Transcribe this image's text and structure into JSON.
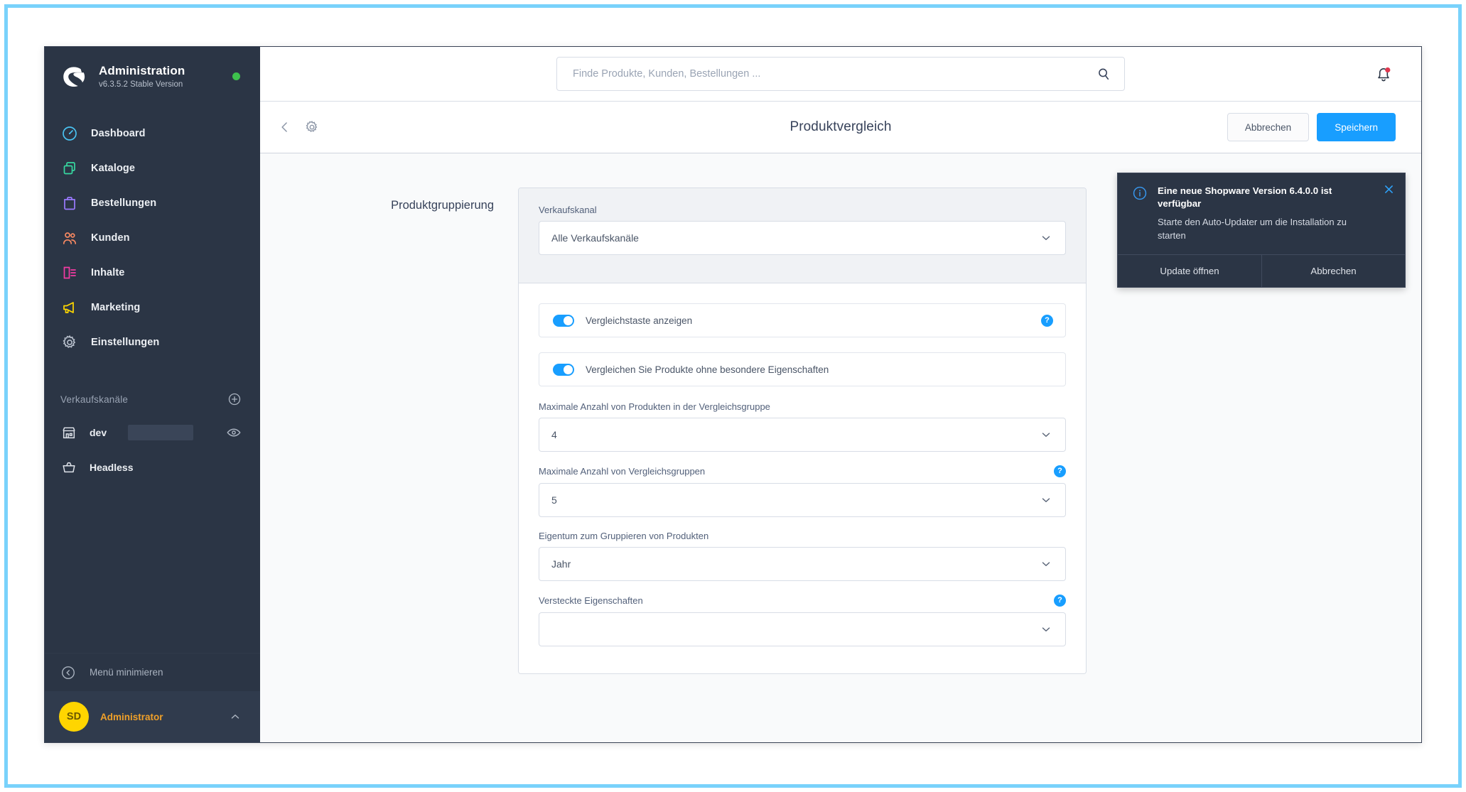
{
  "brand": {
    "title": "Administration",
    "version": "v6.3.5.2 Stable Version",
    "status_color": "#3ec14d",
    "logo_icon": "shopware-logo-icon"
  },
  "sidebar": {
    "items": [
      {
        "label": "Dashboard",
        "icon": "dashboard-icon",
        "color": "#49c2f1"
      },
      {
        "label": "Kataloge",
        "icon": "catalog-icon",
        "color": "#37d8a0"
      },
      {
        "label": "Bestellungen",
        "icon": "orders-bag-icon",
        "color": "#9b7aff"
      },
      {
        "label": "Kunden",
        "icon": "customers-icon",
        "color": "#f88962"
      },
      {
        "label": "Inhalte",
        "icon": "content-icon",
        "color": "#f33ba3"
      },
      {
        "label": "Marketing",
        "icon": "megaphone-icon",
        "color": "#ffd700"
      },
      {
        "label": "Einstellungen",
        "icon": "gear-icon",
        "color": "#b9c1cd"
      }
    ],
    "channels_section": {
      "title": "Verkaufskanäle",
      "add_icon": "plus-circle-icon",
      "items": [
        {
          "label": "dev",
          "icon": "storefront-icon",
          "trailing_icon": "eye-icon",
          "redacted": true
        },
        {
          "label": "Headless",
          "icon": "basket-icon",
          "trailing_icon": "",
          "redacted": false
        }
      ]
    },
    "minimize": {
      "label": "Menü minimieren",
      "icon": "chevron-left-circle-icon"
    },
    "user": {
      "initials": "SD",
      "name": "Administrator",
      "chevron_icon": "chevron-up-icon",
      "avatar_color": "#ffd500",
      "name_color": "#f0a029"
    }
  },
  "topbar": {
    "search": {
      "placeholder": "Finde Produkte, Kunden, Bestellungen ...",
      "value": "",
      "icon": "search-icon"
    },
    "notifications": {
      "icon": "bell-icon",
      "has_badge": true,
      "badge_color": "#e0384f"
    }
  },
  "pagehead": {
    "back_icon": "chevron-left-icon",
    "settings_icon": "gear-icon",
    "title": "Produktvergleich",
    "cancel_label": "Abbrechen",
    "save_label": "Speichern",
    "primary_color": "#189eff"
  },
  "main": {
    "card_label": "Produktgruppierung",
    "sales_channel_field": {
      "label": "Verkaufskanal",
      "value": "Alle Verkaufskanäle"
    },
    "switches": [
      {
        "label": "Vergleichstaste anzeigen",
        "on": true,
        "help": true,
        "help_glyph": "?"
      },
      {
        "label": "Vergleichen Sie Produkte ohne besondere Eigenschaften",
        "on": true,
        "help": false,
        "help_glyph": "?"
      }
    ],
    "fields": [
      {
        "label": "Maximale Anzahl von Produkten in der Vergleichsgruppe",
        "value": "4",
        "help": false,
        "help_glyph": "?"
      },
      {
        "label": "Maximale Anzahl von Vergleichsgruppen",
        "value": "5",
        "help": true,
        "help_glyph": "?"
      },
      {
        "label": "Eigentum zum Gruppieren von Produkten",
        "value": "Jahr",
        "help": false,
        "help_glyph": "?"
      },
      {
        "label": "Versteckte Eigenschaften",
        "value": "",
        "help": true,
        "help_glyph": "?"
      }
    ]
  },
  "notification": {
    "info_icon": "info-circle-icon",
    "close_icon": "close-icon",
    "title": "Eine neue Shopware Version 6.4.0.0 ist verfügbar",
    "message": "Starte den Auto-Updater um die Installation zu starten",
    "primary_action": "Update öffnen",
    "secondary_action": "Abbrechen"
  }
}
